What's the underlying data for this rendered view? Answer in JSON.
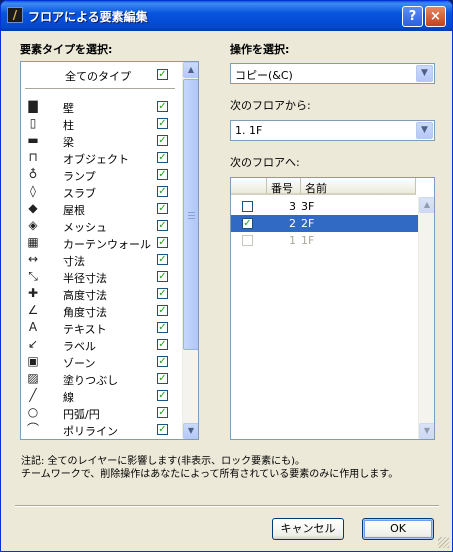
{
  "window": {
    "title": "フロアによる要素編集",
    "help_glyph": "?",
    "close_glyph": "×",
    "app_glyph": "/"
  },
  "left_panel": {
    "label": "要素タイプを選択:",
    "all_label": "全てのタイプ",
    "items": [
      {
        "label": "壁",
        "icon": "wall-icon",
        "glyph": "▇",
        "checked": true
      },
      {
        "label": "柱",
        "icon": "column-icon",
        "glyph": "▯",
        "checked": true
      },
      {
        "label": "梁",
        "icon": "beam-icon",
        "glyph": "▬",
        "checked": true
      },
      {
        "label": "オブジェクト",
        "icon": "object-icon",
        "glyph": "⊓",
        "checked": true
      },
      {
        "label": "ランプ",
        "icon": "lamp-icon",
        "glyph": "♁",
        "checked": true
      },
      {
        "label": "スラブ",
        "icon": "slab-icon",
        "glyph": "◊",
        "checked": true
      },
      {
        "label": "屋根",
        "icon": "roof-icon",
        "glyph": "◆",
        "checked": true
      },
      {
        "label": "メッシュ",
        "icon": "mesh-icon",
        "glyph": "◈",
        "checked": true
      },
      {
        "label": "カーテンウォール",
        "icon": "curtain-wall-icon",
        "glyph": "▦",
        "checked": true
      },
      {
        "label": "寸法",
        "icon": "dimension-icon",
        "glyph": "↔",
        "checked": true
      },
      {
        "label": "半径寸法",
        "icon": "radial-dimension-icon",
        "glyph": "⤡",
        "checked": true
      },
      {
        "label": "高度寸法",
        "icon": "level-dimension-icon",
        "glyph": "✚",
        "checked": true
      },
      {
        "label": "角度寸法",
        "icon": "angle-dimension-icon",
        "glyph": "∠",
        "checked": true
      },
      {
        "label": "テキスト",
        "icon": "text-icon",
        "glyph": "A",
        "checked": true
      },
      {
        "label": "ラベル",
        "icon": "label-icon",
        "glyph": "↙",
        "checked": true
      },
      {
        "label": "ゾーン",
        "icon": "zone-icon",
        "glyph": "▣",
        "checked": true
      },
      {
        "label": "塗りつぶし",
        "icon": "fill-icon",
        "glyph": "▨",
        "checked": true
      },
      {
        "label": "線",
        "icon": "line-icon",
        "glyph": "╱",
        "checked": true
      },
      {
        "label": "円弧/円",
        "icon": "arc-icon",
        "glyph": "○",
        "checked": true
      },
      {
        "label": "ポリライン",
        "icon": "polyline-icon",
        "glyph": "⌒",
        "checked": true
      }
    ]
  },
  "right_panel": {
    "operation_label": "操作を選択:",
    "operation_value": "コピー(&C)",
    "from_label": "次のフロアから:",
    "from_value": "1. 1F",
    "to_label": "次のフロアへ:",
    "columns": [
      "番号",
      "名前"
    ],
    "floors": [
      {
        "num": "3",
        "name": "3F",
        "checked": false,
        "state": "normal"
      },
      {
        "num": "2",
        "name": "2F",
        "checked": true,
        "state": "selected"
      },
      {
        "num": "1",
        "name": "1F",
        "checked": false,
        "state": "disabled"
      }
    ]
  },
  "note": {
    "line1": "注記: 全てのレイヤーに影響します(非表示、ロック要素にも)。",
    "line2": "チームワークで、削除操作はあなたによって所有されている要素のみに作用します。"
  },
  "buttons": {
    "cancel": "キャンセル",
    "ok": "OK"
  },
  "glyphs": {
    "check": "✓",
    "up": "▲",
    "down": "▼"
  },
  "colors": {
    "selection": "#316ac5",
    "titlebar": "#0855dd",
    "check": "#21a121"
  }
}
